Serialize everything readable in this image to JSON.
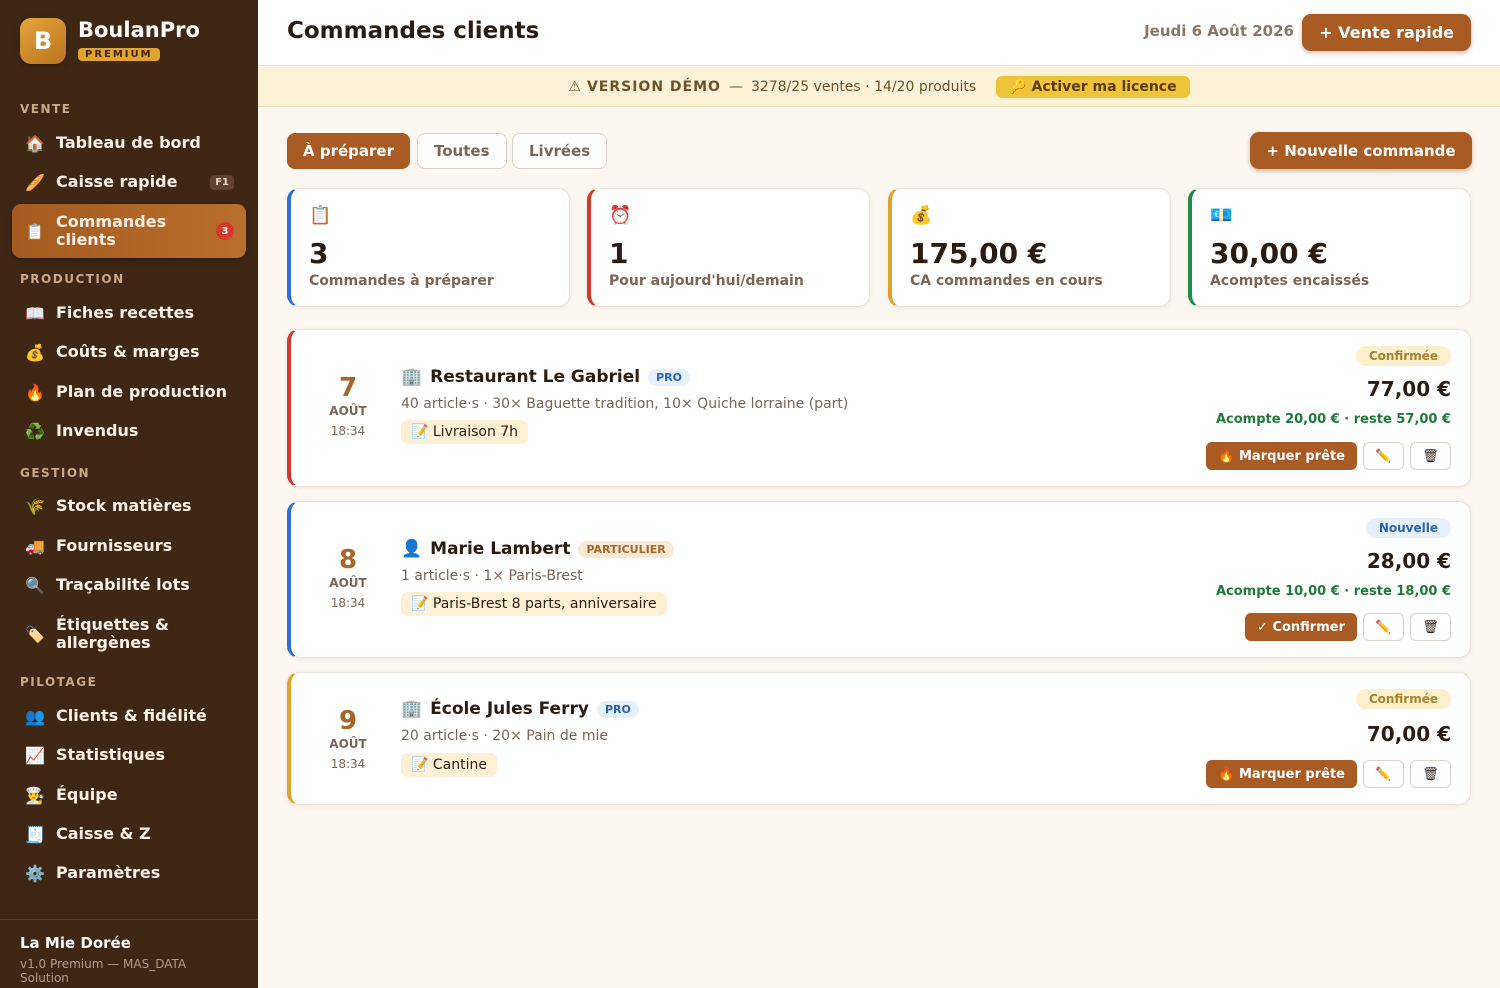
{
  "brand": {
    "logo_letter": "B",
    "name": "BoulanPro",
    "tier": "PREMIUM"
  },
  "sidebar": {
    "sections": [
      {
        "title": "VENTE",
        "items": [
          {
            "icon": "house-icon",
            "glyph": "🏠",
            "label": "Tableau de bord"
          },
          {
            "icon": "baguette-icon",
            "glyph": "🥖",
            "label": "Caisse rapide",
            "shortcut": "F1"
          },
          {
            "icon": "clipboard-icon",
            "glyph": "📋",
            "label": "Commandes clients",
            "badge": "3",
            "active": true
          }
        ]
      },
      {
        "title": "PRODUCTION",
        "items": [
          {
            "icon": "book-icon",
            "glyph": "📖",
            "label": "Fiches recettes"
          },
          {
            "icon": "money-bag-icon",
            "glyph": "💰",
            "label": "Coûts & marges"
          },
          {
            "icon": "fire-icon",
            "glyph": "🔥",
            "label": "Plan de production"
          },
          {
            "icon": "recycle-icon",
            "glyph": "♻️",
            "label": "Invendus"
          }
        ]
      },
      {
        "title": "GESTION",
        "items": [
          {
            "icon": "wheat-icon",
            "glyph": "🌾",
            "label": "Stock matières"
          },
          {
            "icon": "truck-icon",
            "glyph": "🚚",
            "label": "Fournisseurs"
          },
          {
            "icon": "magnifier-icon",
            "glyph": "🔍",
            "label": "Traçabilité lots"
          },
          {
            "icon": "tag-icon",
            "glyph": "🏷️",
            "label": "Étiquettes & allergènes"
          }
        ]
      },
      {
        "title": "PILOTAGE",
        "items": [
          {
            "icon": "people-icon",
            "glyph": "👥",
            "label": "Clients & fidélité"
          },
          {
            "icon": "chart-icon",
            "glyph": "📈",
            "label": "Statistiques"
          },
          {
            "icon": "cook-icon",
            "glyph": "👨‍🍳",
            "label": "Équipe"
          },
          {
            "icon": "receipt-icon",
            "glyph": "🧾",
            "label": "Caisse & Z"
          },
          {
            "icon": "gear-icon",
            "glyph": "⚙️",
            "label": "Paramètres"
          }
        ]
      }
    ],
    "footer": {
      "shop": "La Mie Dorée",
      "version": "v1.0 Premium — MAS_DATA Solution"
    }
  },
  "header": {
    "title": "Commandes clients",
    "date": "Jeudi 6 Août 2026",
    "quick_sale": "+ Vente rapide"
  },
  "banner": {
    "warning_glyph": "⚠",
    "label": "VERSION DÉMO",
    "separator": "—",
    "usage": "3278/25 ventes · 14/20 produits",
    "license_button": "🔑 Activer ma licence"
  },
  "tabs": [
    {
      "label": "À préparer",
      "active": true
    },
    {
      "label": "Toutes"
    },
    {
      "label": "Livrées"
    }
  ],
  "new_order_button": "+ Nouvelle commande",
  "stats": [
    {
      "glyph": "📋",
      "icon": "clipboard-icon",
      "value": "3",
      "label": "Commandes à préparer",
      "color": "#2f6fd6"
    },
    {
      "glyph": "⏰",
      "icon": "alarm-clock-icon",
      "value": "1",
      "label": "Pour aujourd'hui/demain",
      "color": "#d23a2c"
    },
    {
      "glyph": "💰",
      "icon": "money-bag-icon",
      "value": "175,00 €",
      "label": "CA commandes en cours",
      "color": "#e0a32e"
    },
    {
      "glyph": "💶",
      "icon": "euro-banknote-icon",
      "value": "30,00 €",
      "label": "Acomptes encaissés",
      "color": "#1f8a4a"
    }
  ],
  "orders": [
    {
      "day": "7",
      "month": "AOÛT",
      "time": "18:34",
      "type_glyph": "🏢",
      "type_icon": "office-building-icon",
      "name": "Restaurant Le Gabriel",
      "type": "PRO",
      "details": "40 article·s · 30× Baguette tradition, 10× Quiche lorraine (part)",
      "note": "📝 Livraison 7h",
      "status": "Confirmée",
      "amount": "77,00 €",
      "deposit": "Acompte 20,00 € · reste 57,00 €",
      "action": "🔥 Marquer prête",
      "edit": "✏️",
      "delete": "🗑",
      "border": "#d23a2c"
    },
    {
      "day": "8",
      "month": "AOÛT",
      "time": "18:34",
      "type_glyph": "👤",
      "type_icon": "person-icon",
      "name": "Marie Lambert",
      "type": "PARTICULIER",
      "details": "1 article·s · 1× Paris-Brest",
      "note": "📝 Paris-Brest 8 parts, anniversaire",
      "status": "Nouvelle",
      "amount": "28,00 €",
      "deposit": "Acompte 10,00 € · reste 18,00 €",
      "action": "✓ Confirmer",
      "edit": "✏️",
      "delete": "🗑",
      "border": "#2f6fd6"
    },
    {
      "day": "9",
      "month": "AOÛT",
      "time": "18:34",
      "type_glyph": "🏢",
      "type_icon": "office-building-icon",
      "name": "École Jules Ferry",
      "type": "PRO",
      "details": "20 article·s · 20× Pain de mie",
      "note": "📝 Cantine",
      "status": "Confirmée",
      "amount": "70,00 €",
      "action": "🔥 Marquer prête",
      "edit": "✏️",
      "delete": "🗑",
      "border": "#e0a32e"
    }
  ]
}
